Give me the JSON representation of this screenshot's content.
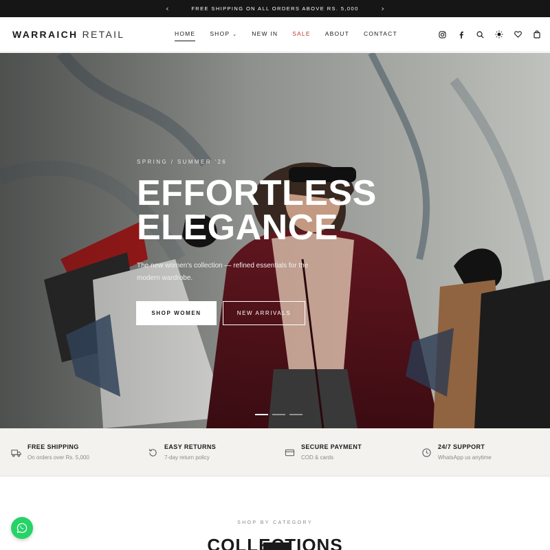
{
  "announcement": {
    "text": "FREE SHIPPING ON ALL ORDERS ABOVE RS. 5,000",
    "prev_icon": "chevron-left-icon",
    "next_icon": "chevron-right-icon"
  },
  "header": {
    "logo_bold": "WARRAICH",
    "logo_light": "RETAIL",
    "nav": [
      {
        "label": "HOME",
        "active": true
      },
      {
        "label": "SHOP",
        "has_dropdown": true
      },
      {
        "label": "NEW IN"
      },
      {
        "label": "SALE",
        "color": "#c0392b"
      },
      {
        "label": "ABOUT"
      },
      {
        "label": "CONTACT"
      }
    ],
    "icons": [
      "instagram-icon",
      "facebook-icon",
      "search-icon",
      "theme-sun-icon",
      "wishlist-heart-icon",
      "cart-bag-icon"
    ]
  },
  "hero": {
    "eyebrow": "SPRING / SUMMER '26",
    "headline_line1": "EFFORTLESS",
    "headline_line2": "ELEGANCE",
    "subtext": "The new women's collection — refined essentials for the modern wardrobe.",
    "primary_button": "SHOP WOMEN",
    "secondary_button": "NEW ARRIVALS",
    "slides_total": 3,
    "slide_active": 1
  },
  "features": [
    {
      "icon": "truck-icon",
      "title": "FREE SHIPPING",
      "desc": "On orders over Rs. 5,000"
    },
    {
      "icon": "returns-icon",
      "title": "EASY RETURNS",
      "desc": "7-day return policy"
    },
    {
      "icon": "card-icon",
      "title": "SECURE PAYMENT",
      "desc": "COD & cards"
    },
    {
      "icon": "clock-icon",
      "title": "24/7 SUPPORT",
      "desc": "WhatsApp us anytime"
    }
  ],
  "categories": {
    "eyebrow": "SHOP BY CATEGORY",
    "title": "COLLECTIONS"
  },
  "whatsapp": {
    "icon": "whatsapp-icon",
    "color": "#25d366"
  },
  "colors": {
    "accent_sale": "#c0392b",
    "dark": "#161616",
    "feature_bg": "#f4f2ee"
  }
}
